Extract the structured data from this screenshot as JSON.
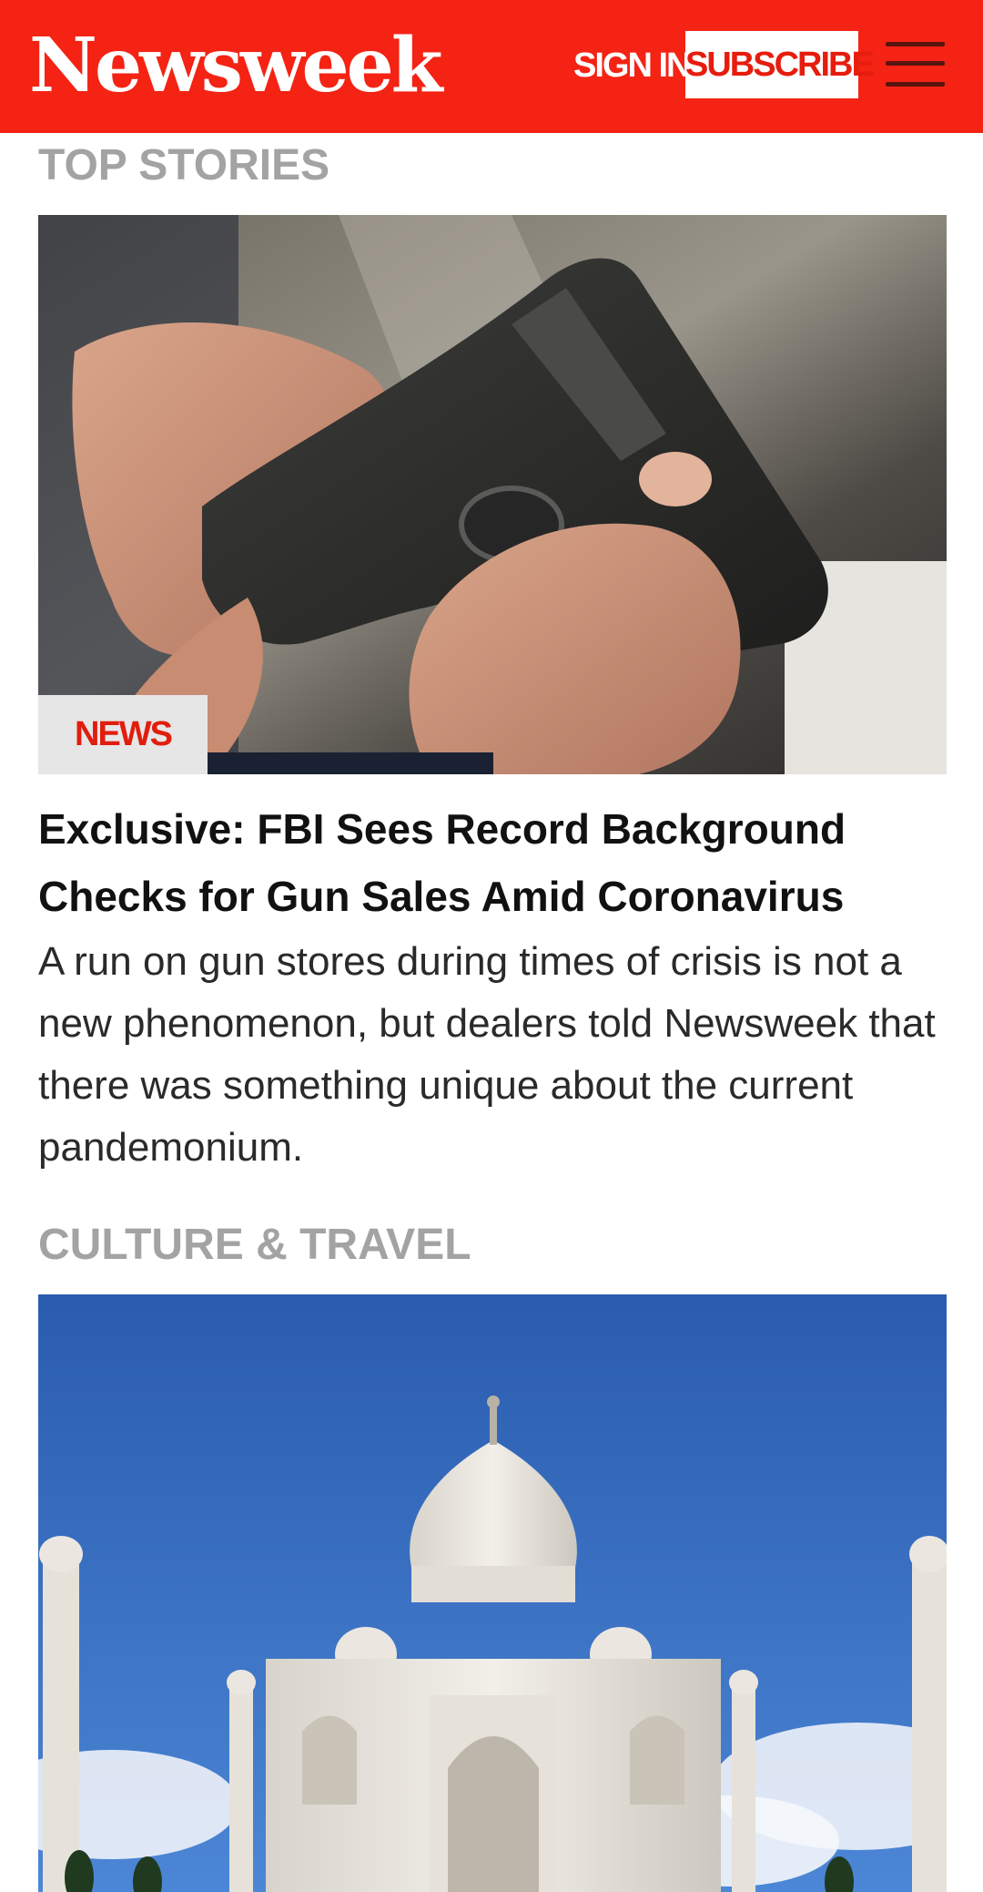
{
  "header": {
    "logo_text": "Newsweek",
    "signin_label": "SIGN IN",
    "subscribe_label": "SUBSCRIBE",
    "menu_icon": "hamburger-menu-icon",
    "brand_color": "#f42314"
  },
  "sections": {
    "top_stories": {
      "label": "TOP STORIES",
      "story": {
        "image_description_icon": "handgun-photo",
        "category": "NEWS",
        "headline": "Exclusive: FBI Sees Record Background Checks for Gun Sales Amid Coronavirus",
        "summary": "A run on gun stores during times of crisis is not a new phenomenon, but dealers told Newsweek that there was something unique about the current pandemonium."
      }
    },
    "culture_travel": {
      "label": "CULTURE & TRAVEL",
      "story": {
        "image_description_icon": "taj-mahal-photo"
      }
    }
  }
}
